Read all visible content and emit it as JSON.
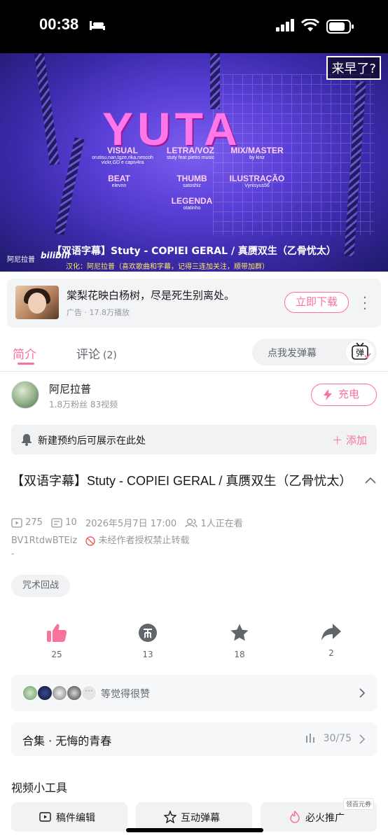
{
  "status_bar": {
    "time": "00:38"
  },
  "video": {
    "corner_badge": "来早了?",
    "title_art": "YUTA",
    "credits": [
      {
        "role": "VISUAL",
        "names": "orutisu.nan,tgze,rika,nescoh vickr,GD e capiv4ra"
      },
      {
        "role": "LETRA/VOZ",
        "names": "stuty feat pietro music"
      },
      {
        "role": "MIX/MASTER",
        "names": "by kinz"
      },
      {
        "role": "BEAT",
        "names": "elevnn"
      },
      {
        "role": "THUMB",
        "names": "satoshiz"
      },
      {
        "role": "ILUSTRAÇÃO",
        "names": "Vynisyus56"
      },
      {
        "role": "LEGENDA",
        "names": "otatinho"
      }
    ],
    "channel_mark": "阿尼拉普",
    "logo": "bilibili",
    "subtitle_line1": "【双语字幕】Stuty - COPIEI GERAL / 真赝双生（乙骨忧太）",
    "subtitle_line2": "汉化：阿尼拉普（喜欢歌曲和字幕，记得三连加关注，顺带加群）"
  },
  "ad": {
    "text": "棠梨花映白杨树，尽是死生别离处。",
    "meta": "广告 · 17.8万播放",
    "download_label": "立即下载"
  },
  "tabs": {
    "intro": "简介",
    "comments": "评论",
    "comments_count": "(2)",
    "danmu_placeholder": "点我发弹幕",
    "danmu_button": "弹"
  },
  "uploader": {
    "name": "阿尼拉普",
    "stats": "1.8万粉丝  83视频",
    "charge_label": "充电"
  },
  "reservation": {
    "text": "新建预约后可展示在此处",
    "add_label": "＋ 添加"
  },
  "video_info": {
    "title": "【双语字幕】Stuty - COPIEI GERAL / 真赝双生（乙骨忧太）",
    "plays": "275",
    "danmaku": "10",
    "datetime": "2026年5月7日 17:00",
    "watching": "1人正在看",
    "bvid": "BV1RtdwBTEiz",
    "no_repost": "未经作者授权禁止转载",
    "desc": "-",
    "tag": "咒术回战"
  },
  "actions": {
    "like_count": "25",
    "coin_count": "13",
    "fav_count": "18",
    "share_count": "2"
  },
  "like_bar": {
    "text": "等觉得很赞"
  },
  "collection": {
    "name": "合集 · 无悔的青春",
    "progress": "30/75"
  },
  "tools": {
    "title": "视频小工具",
    "coupon": "领百元券",
    "items": [
      "稿件编辑",
      "互动弹幕",
      "必火推广"
    ]
  },
  "colors": {
    "accent": "#fb7299",
    "muted": "#9499a0"
  }
}
